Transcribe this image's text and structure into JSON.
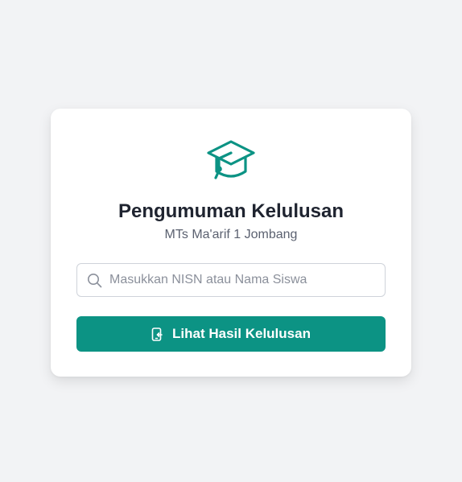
{
  "card": {
    "icon": "graduation-cap-icon",
    "title": "Pengumuman Kelulusan",
    "subtitle": "MTs Ma'arif 1 Jombang"
  },
  "search": {
    "icon": "search-icon",
    "placeholder": "Masukkan NISN atau Nama Siswa",
    "value": ""
  },
  "submit": {
    "icon": "phone-arrow-icon",
    "label": "Lihat Hasil Kelulusan"
  },
  "colors": {
    "accent": "#0c9384",
    "background": "#f2f3f5",
    "title": "#1f2430",
    "subtitle": "#5b6170"
  }
}
